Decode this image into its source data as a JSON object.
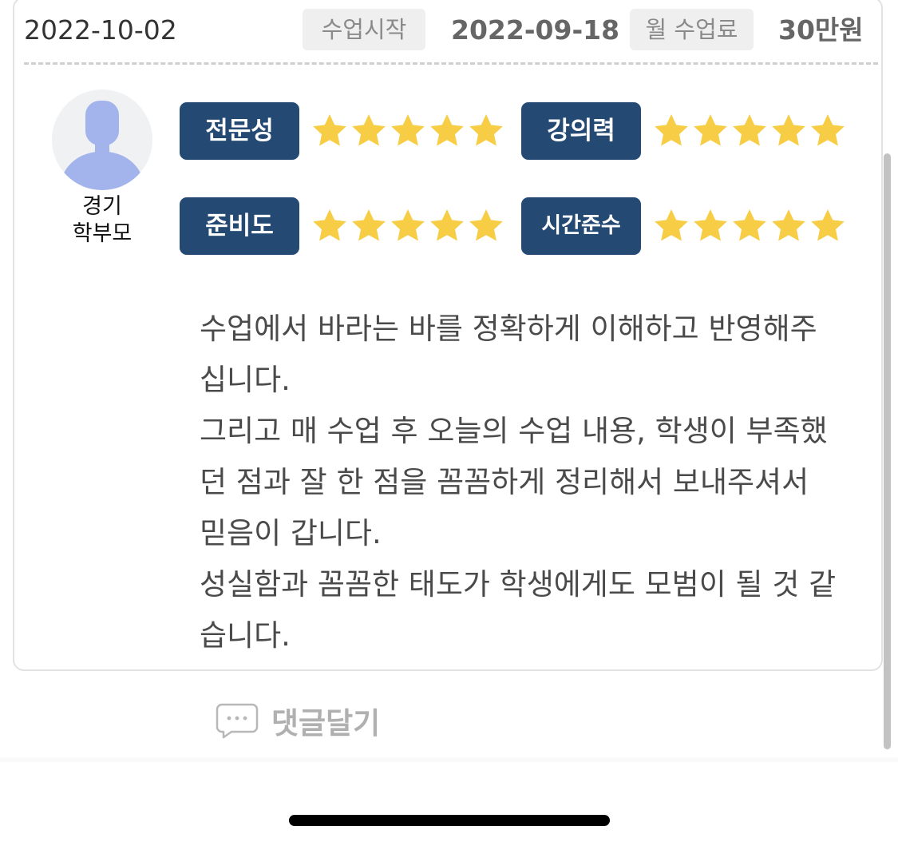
{
  "review": {
    "date": "2022-10-02",
    "start_label": "수업시작",
    "start_value": "2022-09-18",
    "fee_label": "월 수업료",
    "fee_value": "30만원"
  },
  "author": {
    "region": "경기",
    "role": "학부모",
    "avatar_icon": "user-silhouette-icon"
  },
  "ratings": [
    {
      "label": "전문성",
      "stars": 5,
      "max": 5
    },
    {
      "label": "강의력",
      "stars": 5,
      "max": 5
    },
    {
      "label": "준비도",
      "stars": 5,
      "max": 5
    },
    {
      "label": "시간준수",
      "stars": 5,
      "max": 5
    }
  ],
  "body": {
    "paragraphs": [
      "수업에서 바라는 바를 정확하게 이해하고 반영해주십니다.",
      "그리고 매 수업 후 오늘의 수업 내용, 학생이 부족했던 점과 잘 한 점을 꼼꼼하게 정리해서 보내주셔서 믿음이 갑니다.",
      "성실함과 꼼꼼한 태도가 학생에게도 모범이 될 것 같습니다."
    ]
  },
  "comment": {
    "label": "댓글달기",
    "icon": "speech-bubble-icon"
  },
  "colors": {
    "badge": "#244a74",
    "star": "#f7cd45",
    "avatar_figure": "#a3b4ec"
  }
}
